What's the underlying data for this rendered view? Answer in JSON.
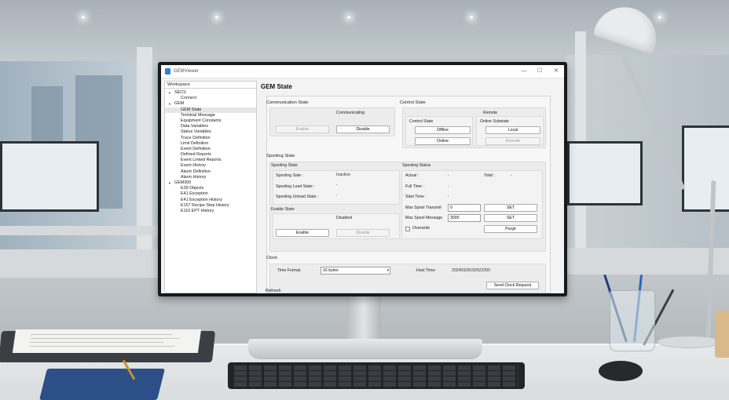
{
  "app": {
    "title": "GEMViewer"
  },
  "window_controls": {
    "minimize": "—",
    "maximize": "☐",
    "close": "✕"
  },
  "sidebar": {
    "header": "Workspace",
    "items": [
      {
        "label": "SECS",
        "level": 0,
        "expanded": true
      },
      {
        "label": "Connect",
        "level": 1
      },
      {
        "label": "GEM",
        "level": 0,
        "expanded": true
      },
      {
        "label": "GEM State",
        "level": 1,
        "selected": true
      },
      {
        "label": "Terminal Message",
        "level": 1
      },
      {
        "label": "Equipment Constants",
        "level": 1
      },
      {
        "label": "Data Variables",
        "level": 1
      },
      {
        "label": "Status Variables",
        "level": 1
      },
      {
        "label": "Trace Definition",
        "level": 1
      },
      {
        "label": "Limit Definition",
        "level": 1
      },
      {
        "label": "Event Definition",
        "level": 1
      },
      {
        "label": "Defined Reports",
        "level": 1
      },
      {
        "label": "Event Linked Reports",
        "level": 1
      },
      {
        "label": "Event History",
        "level": 1
      },
      {
        "label": "Alarm Definition",
        "level": 1
      },
      {
        "label": "Alarm History",
        "level": 1
      },
      {
        "label": "GEM300",
        "level": 0,
        "expanded": true
      },
      {
        "label": "E39 Objects",
        "level": 1
      },
      {
        "label": "E41 Exception",
        "level": 1
      },
      {
        "label": "E41 Exception History",
        "level": 1
      },
      {
        "label": "E157 Recipe Step History",
        "level": 1
      },
      {
        "label": "E116 EPT History",
        "level": 1
      }
    ]
  },
  "main": {
    "title": "GEM State",
    "communication": {
      "label": "Communication State",
      "status": "Communicating",
      "enable": "Enable",
      "disable": "Disable"
    },
    "control": {
      "label": "Control State",
      "status": "Remote",
      "control_state_label": "Control State",
      "offline": "Offline",
      "online": "Online",
      "online_substate_label": "Online Substate",
      "local": "Local",
      "remote": "Remote"
    },
    "spooling": {
      "label": "Spooling State",
      "state_box_label": "Spooling State",
      "spooling_state_label": "Spooling Sate :",
      "spooling_state_value": "Inactive",
      "load_state_label": "Spooling Load State :",
      "load_state_value": "-",
      "unload_state_label": "Spooling Unload State :",
      "unload_state_value": "-",
      "enable_state_label": "Enable State",
      "enable_state_value": "Disabled",
      "enable": "Enable",
      "disable": "Disable",
      "status_label": "Spooling Status",
      "actual_label": "Actual :",
      "actual_value": "-",
      "total_label": "Total :",
      "total_value": "-",
      "full_time_label": "Full Time :",
      "full_time_value": "-",
      "start_time_label": "Start Time :",
      "start_time_value": "-",
      "max_transmit_label": "Max Spool Transmit",
      "max_transmit_value": "0",
      "max_message_label": "Max Spool Message",
      "max_message_value": "3000",
      "set": "SET",
      "overwrite_label": "Overwrite",
      "overwrite_checked": false,
      "purge": "Purge"
    },
    "clock": {
      "label": "Clock",
      "time_format_label": "Time Format",
      "time_format_value": "16 bytes",
      "host_time_label": "Host Time:",
      "host_time_value": "20240328192522200",
      "send_request": "Send Clock Request"
    },
    "refresh_label": "Refresh"
  }
}
